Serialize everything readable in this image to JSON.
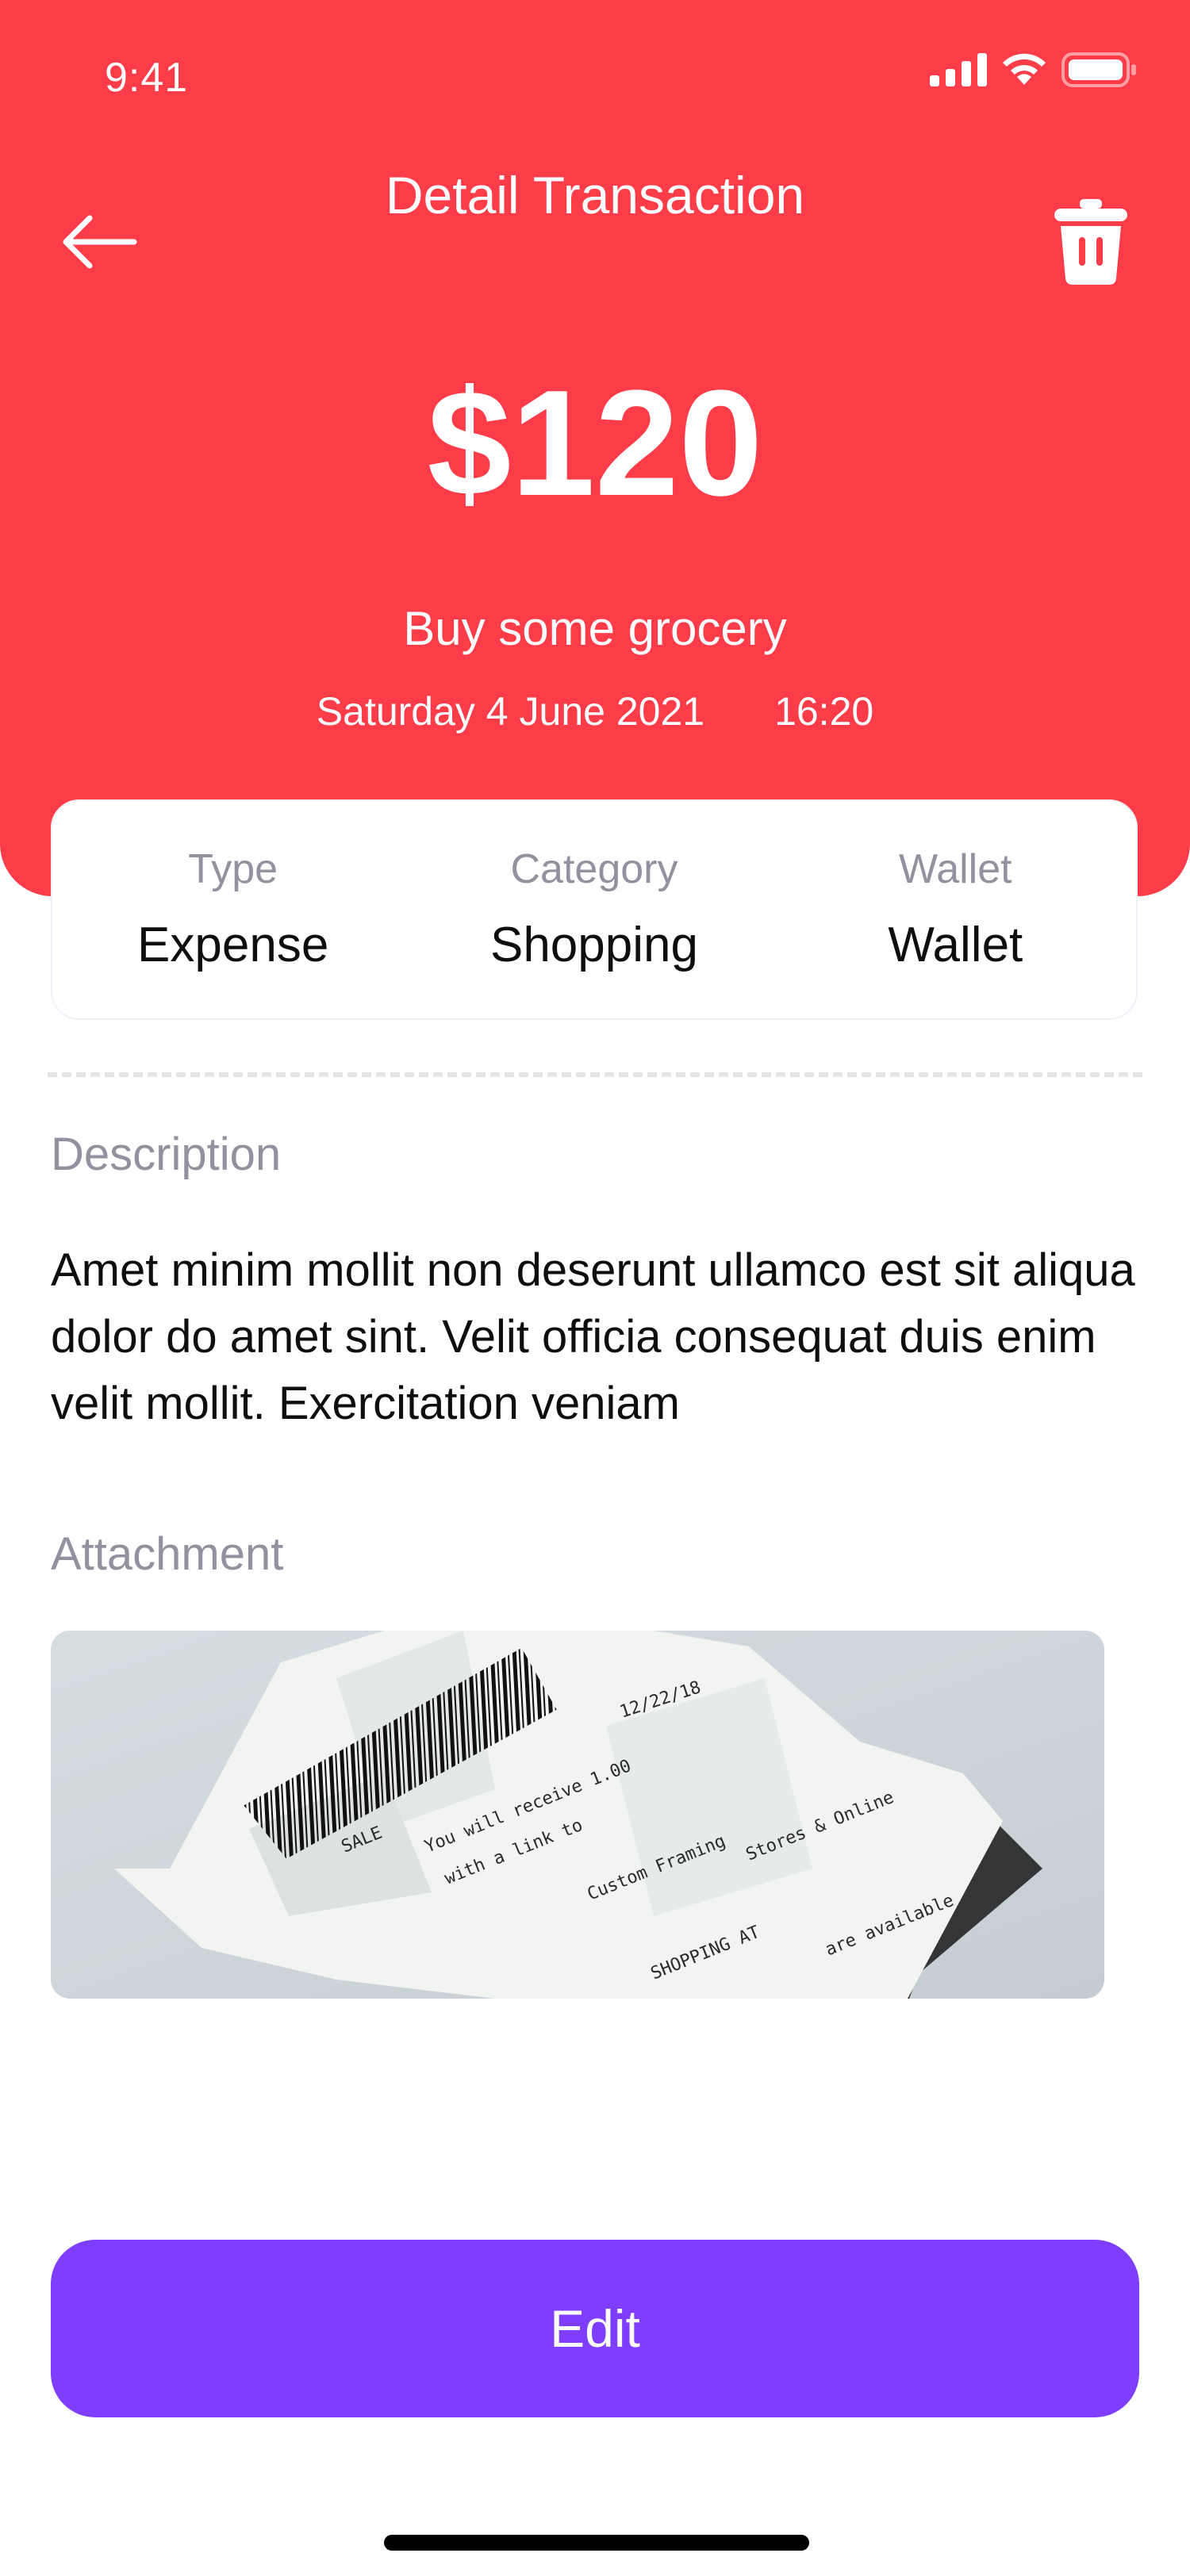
{
  "status_bar": {
    "time": "9:41"
  },
  "nav": {
    "title": "Detail Transaction",
    "back_icon": "arrow-left-icon",
    "delete_icon": "trash-icon"
  },
  "transaction": {
    "amount": "$120",
    "title": "Buy some grocery",
    "date": "Saturday 4 June 2021",
    "time": "16:20"
  },
  "info": {
    "type_label": "Type",
    "type_value": "Expense",
    "category_label": "Category",
    "category_value": "Shopping",
    "wallet_label": "Wallet",
    "wallet_value": "Wallet"
  },
  "description": {
    "label": "Description",
    "text": "Amet minim mollit non deserunt ullamco est sit aliqua dolor do amet sint. Velit officia consequat duis enim velit mollit. Exercitation veniam"
  },
  "attachment": {
    "label": "Attachment",
    "receipt_lines": [
      "SALE",
      "12/22/18",
      "You will receive 1.00",
      "with a link to",
      "Custom Framing",
      "Stores & Online",
      "SHOPPING AT",
      "are available"
    ]
  },
  "actions": {
    "edit_label": "Edit"
  },
  "colors": {
    "header": "#FD3C4A",
    "primary": "#7F3DFF",
    "muted": "#91919F",
    "text": "#0D0E0F"
  }
}
